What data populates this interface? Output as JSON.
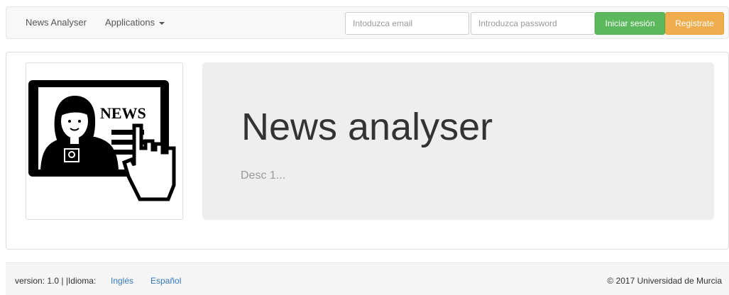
{
  "navbar": {
    "brand": "News Analyser",
    "applications": "Applications",
    "email_placeholder": "Intoduzca email",
    "password_placeholder": "Introduzca password",
    "login_label": "Iniciar sesión",
    "register_label": "Registrate"
  },
  "main": {
    "thumbnail": {
      "sign_text": "NEWS"
    },
    "title": "News analyser",
    "description": "Desc 1..."
  },
  "footer": {
    "version_text": "version: 1.0 | |Idioma:",
    "languages": [
      "Inglés",
      "Español"
    ],
    "copyright": "© 2017 Universidad de Murcia"
  },
  "colors": {
    "login": "#5cb85c",
    "register": "#f0ad4e",
    "link": "#337ab7",
    "jumbotron": "#eeeeee"
  }
}
